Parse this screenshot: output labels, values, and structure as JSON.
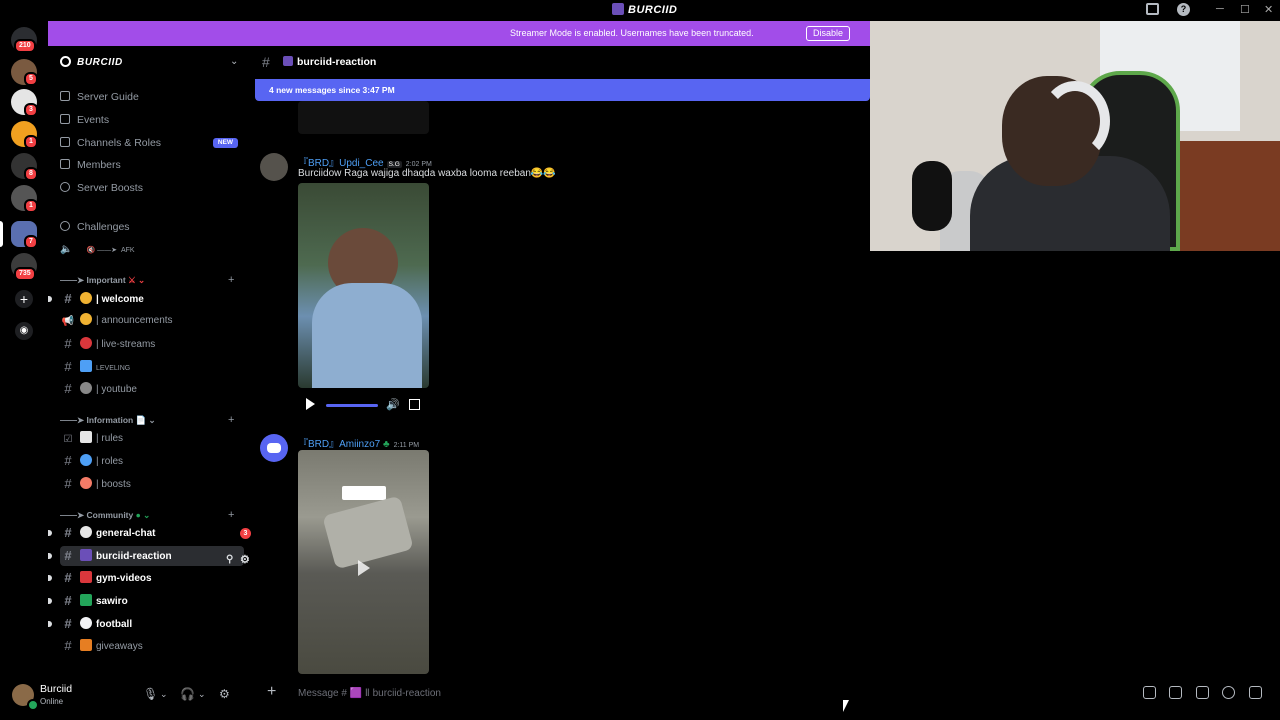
{
  "window": {
    "title": "BURCIID"
  },
  "rail": {
    "badges": [
      "210",
      "5",
      "3",
      "1",
      "8",
      "1",
      "7",
      "735"
    ]
  },
  "banner": {
    "text": "Streamer Mode is enabled. Usernames have been truncated.",
    "button": "Disable"
  },
  "sidebar": {
    "guild_name": "BURCIID",
    "nav": {
      "server_guide": "Server Guide",
      "events": "Events",
      "channels_roles": "Channels & Roles",
      "new_badge": "NEW",
      "members": "Members",
      "server_boosts": "Server Boosts",
      "challenges": "Challenges",
      "afk": "AFK"
    },
    "categories": {
      "important": "Important",
      "information": "Information",
      "community": "Community"
    },
    "channels": {
      "welcome": "| welcome",
      "announcements": "| announcements",
      "live_streams": "| live-streams",
      "leveling": "LEVELING",
      "youtube": "| youtube",
      "rules": "| rules",
      "roles": "| roles",
      "boosts": "| boosts",
      "general_chat": "general-chat",
      "general_chat_mentions": "3",
      "burciid_reaction": "burciid-reaction",
      "gym_videos": "gym-videos",
      "sawiro": "sawiro",
      "football": "football",
      "giveaways": "giveaways"
    },
    "colors": {
      "accent": "#5865f2",
      "mention": "#f23f43"
    }
  },
  "user": {
    "name": "Burciid",
    "status": "Online"
  },
  "chat": {
    "channel_name": "burciid-reaction",
    "new_messages": "4 new messages since 3:47 PM",
    "messages": [
      {
        "author": "『BRD』Updi_Cee",
        "tag": "S.G",
        "time": "2:02 PM",
        "text": "Burciidow Raga wajiga dhaqda waxba looma reeban😂😂"
      },
      {
        "author": "『BRD』Amiinzo7",
        "time": "2:11 PM",
        "text": ""
      }
    ]
  },
  "composer": {
    "placeholder": "Message # 🟪 Ⅱ burciid-reaction"
  }
}
